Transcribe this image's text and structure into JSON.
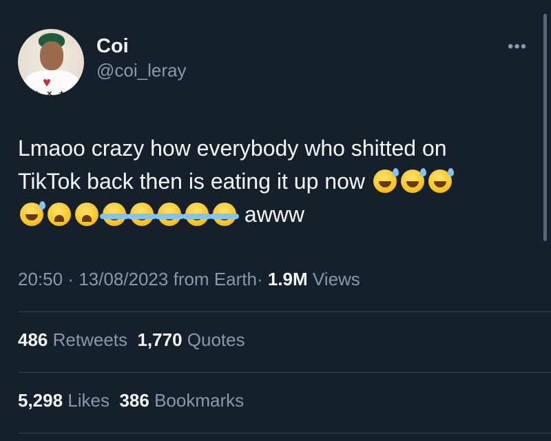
{
  "user": {
    "display_name": "Coi",
    "handle": "@coi_leray",
    "avatar_icon": "profile-photo"
  },
  "more_label": "•••",
  "tweet": {
    "line1_text": "Lmaoo crazy how everybody who shitted on",
    "line2_text": "TikTok back then is eating it up now",
    "line3_suffix": "awww",
    "emoji_icons": [
      "grinning-sweat",
      "grinning-sweat",
      "grinning-sweat",
      "grinning-sweat",
      "weary-face",
      "weary-face",
      "tears-of-joy",
      "tears-of-joy",
      "tears-of-joy",
      "tears-of-joy",
      "tears-of-joy"
    ]
  },
  "meta": {
    "time": "20:50",
    "separator": "·",
    "date": "13/08/2023",
    "source": "from Earth",
    "views_count": "1.9M",
    "views_label": "Views"
  },
  "stats": {
    "retweets_count": "486",
    "retweets_label": "Retweets",
    "quotes_count": "1,770",
    "quotes_label": "Quotes",
    "likes_count": "5,298",
    "likes_label": "Likes",
    "bookmarks_count": "386",
    "bookmarks_label": "Bookmarks"
  },
  "colors": {
    "background": "#15202b",
    "text_primary": "#f7f9f9",
    "text_secondary": "#8b98a5",
    "divider": "#38444d"
  }
}
